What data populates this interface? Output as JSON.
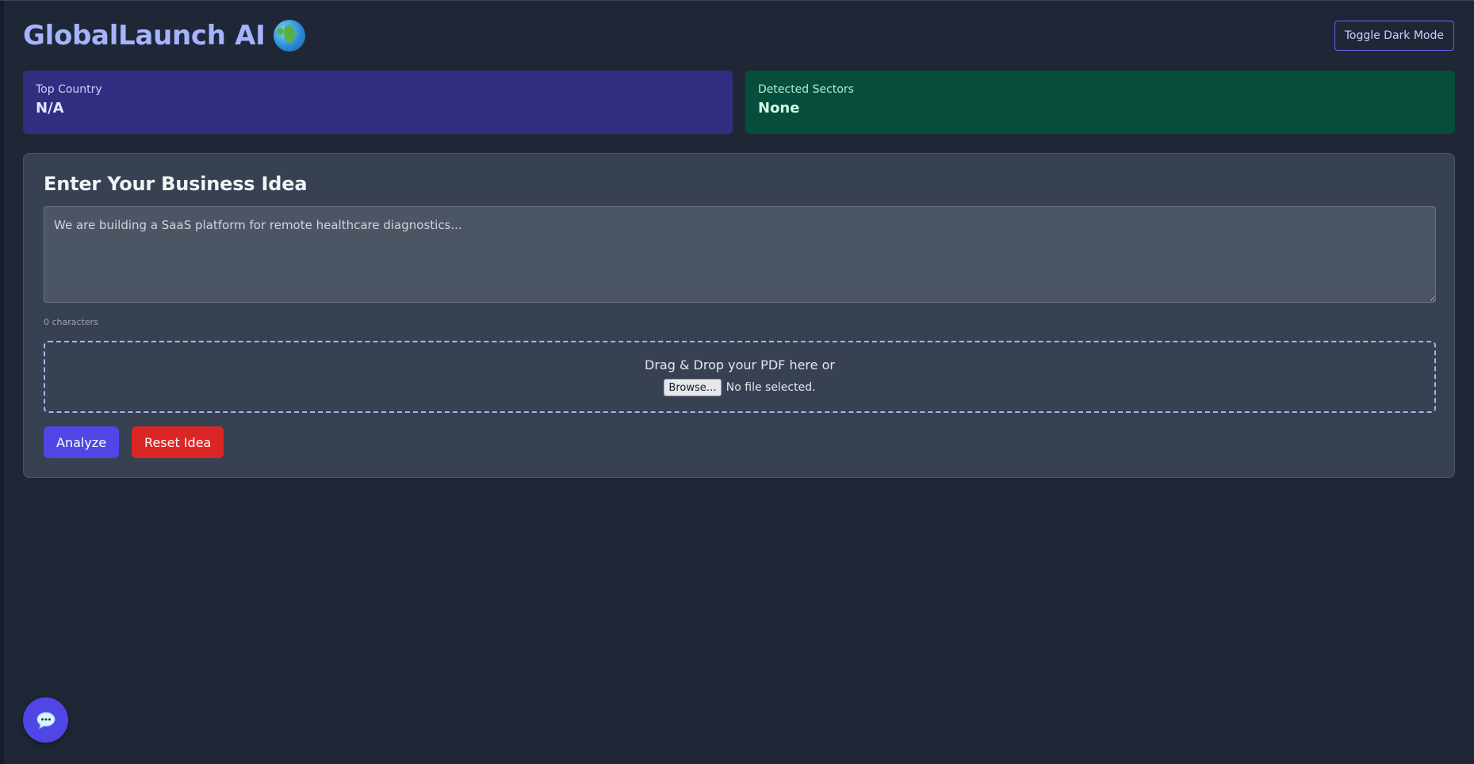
{
  "header": {
    "title": "GlobalLaunch AI",
    "logo_icon": "globe-icon",
    "toggle_label": "Toggle Dark Mode"
  },
  "stats": {
    "top_country": {
      "label": "Top Country",
      "value": "N/A",
      "color": "#312e81"
    },
    "detected_sectors": {
      "label": "Detected Sectors",
      "value": "None",
      "color": "#064e3b"
    }
  },
  "idea_form": {
    "title": "Enter Your Business Idea",
    "placeholder": "We are building a SaaS platform for remote healthcare diagnostics...",
    "char_count": "0 characters",
    "drop_text": "Drag & Drop your PDF here or",
    "browse_label": "Browse…",
    "file_status": "No file selected.",
    "analyze_label": "Analyze",
    "reset_label": "Reset Idea"
  },
  "chat": {
    "icon": "chat-bubble-icon"
  },
  "colors": {
    "background": "#1f2737",
    "accent": "#4f46e5",
    "danger": "#dc2626",
    "brand_text": "#a5b4fc"
  }
}
